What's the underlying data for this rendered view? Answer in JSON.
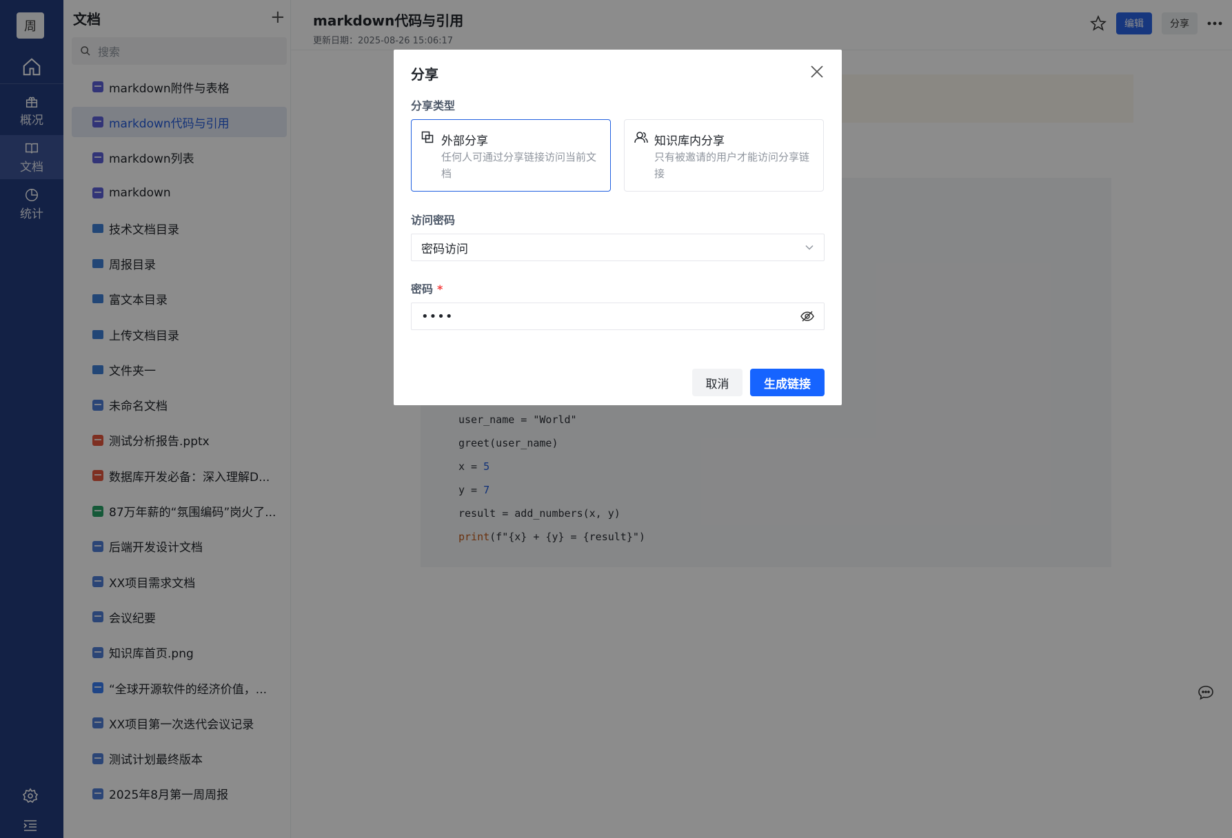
{
  "rail": {
    "avatar": "周",
    "items": [
      {
        "label": "概况"
      },
      {
        "label": "文档"
      },
      {
        "label": "统计"
      }
    ]
  },
  "tree": {
    "title": "文档",
    "add": "+",
    "search_placeholder": "搜索",
    "items": [
      {
        "label": "markdown附件与表格",
        "type": "md"
      },
      {
        "label": "markdown代码与引用",
        "type": "md"
      },
      {
        "label": "markdown列表",
        "type": "md"
      },
      {
        "label": "markdown",
        "type": "md"
      },
      {
        "label": "技术文档目录",
        "type": "folder"
      },
      {
        "label": "周报目录",
        "type": "folder"
      },
      {
        "label": "富文本目录",
        "type": "folder"
      },
      {
        "label": "上传文档目录",
        "type": "folder"
      },
      {
        "label": "文件夹一",
        "type": "folder"
      },
      {
        "label": "未命名文档",
        "type": "doc"
      },
      {
        "label": "测试分析报告.pptx",
        "type": "ppt"
      },
      {
        "label": "数据库开发必备：深入理解D...",
        "type": "ppt"
      },
      {
        "label": "87万年薪的“氛围编码”岗火了...",
        "type": "xls"
      },
      {
        "label": "后端开发设计文档",
        "type": "doc"
      },
      {
        "label": "XX项目需求文档",
        "type": "doc"
      },
      {
        "label": "会议纪要",
        "type": "doc"
      },
      {
        "label": "知识库首页.png",
        "type": "img"
      },
      {
        "label": "“全球开源软件的经济价值，...",
        "type": "word"
      },
      {
        "label": "XX项目第一次迭代会议记录",
        "type": "doc"
      },
      {
        "label": "测试计划最终版本",
        "type": "doc"
      },
      {
        "label": "2025年8月第一周周报",
        "type": "doc"
      }
    ]
  },
  "main": {
    "title": "markdown代码与引用",
    "date": "更新日期：2025-08-26 15:06:17",
    "edit_label": "编辑",
    "share_label": "分享",
    "code": {
      "l1a": "user_name = ",
      "l1b": "\"World\"",
      "l2": "greet(user_name)",
      "l3a": "x = ",
      "l3b": "5",
      "l4a": "y = ",
      "l4b": "7",
      "l5": "result = add_numbers(x, y)",
      "l6a": "print",
      "l6b": "(f\"{x} + {y} = {result}\")"
    }
  },
  "modal": {
    "title": "分享",
    "share_type_label": "分享类型",
    "external": {
      "title": "外部分享",
      "desc": "任何人可通过分享链接访问当前文档"
    },
    "internal": {
      "title": "知识库内分享",
      "desc": "只有被邀请的用户才能访问分享链接"
    },
    "access_label": "访问密码",
    "access_value": "密码访问",
    "password_label": "密码",
    "required_mark": "*",
    "password_value": "••••",
    "cancel": "取消",
    "generate": "生成链接"
  }
}
